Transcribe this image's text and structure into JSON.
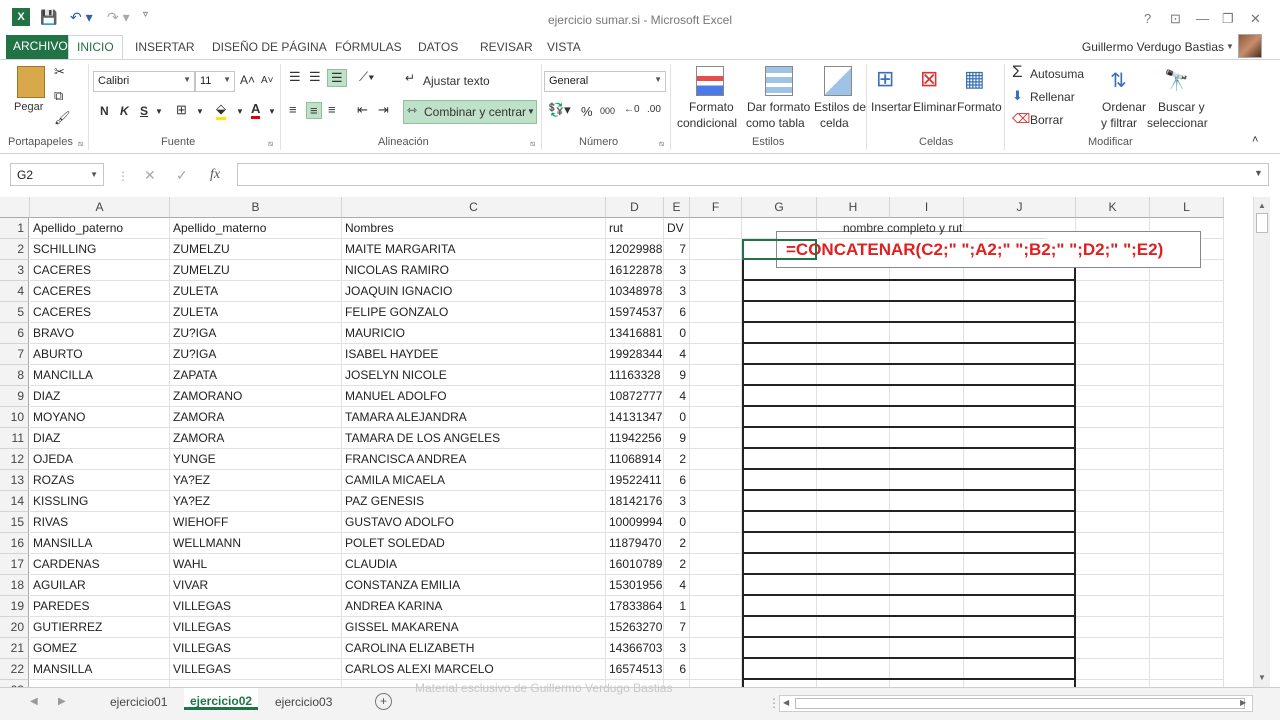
{
  "app": {
    "title": "ejercicio sumar.si - Microsoft Excel",
    "user_name": "Guillermo Verdugo Bastias",
    "help_glyph": "?",
    "minimize_glyph": "—",
    "restore_glyph": "❐",
    "close_glyph": "✕"
  },
  "ribbon_tabs": [
    "ARCHIVO",
    "INICIO",
    "INSERTAR",
    "DISEÑO DE PÁGINA",
    "FÓRMULAS",
    "DATOS",
    "REVISAR",
    "VISTA"
  ],
  "ribbon": {
    "paste_label": "Pegar",
    "clipboard_group": "Portapapeles",
    "font_name": "Calibri",
    "font_size": "11",
    "font_group": "Fuente",
    "bold": "N",
    "italic": "K",
    "underline": "S",
    "wrap_text": "Ajustar texto",
    "merge_center": "Combinar y centrar",
    "alignment_group": "Alineación",
    "number_format": "General",
    "number_group": "Número",
    "percent": "%",
    "thousands": "000",
    "cond_format_1": "Formato",
    "cond_format_2": "condicional",
    "format_table_1": "Dar formato",
    "format_table_2": "como tabla",
    "cell_styles_1": "Estilos de",
    "cell_styles_2": "celda",
    "styles_group": "Estilos",
    "insert_label": "Insertar",
    "delete_label": "Eliminar",
    "format_label": "Formato",
    "cells_group": "Celdas",
    "autosum": "Autosuma",
    "fill": "Rellenar",
    "clear": "Borrar",
    "sort_1": "Ordenar",
    "sort_2": "y filtrar",
    "find_1": "Buscar y",
    "find_2": "seleccionar",
    "editing_group": "Modificar"
  },
  "formula_bar": {
    "name_box": "G2",
    "formula": ""
  },
  "columns": [
    "A",
    "B",
    "C",
    "D",
    "E",
    "F",
    "G",
    "H",
    "I",
    "J",
    "K",
    "L"
  ],
  "headers": {
    "a": "Apellido_paterno",
    "b": "Apellido_materno",
    "c": "Nombres",
    "d": "rut",
    "e": "DV",
    "h": "nombre completo y rut"
  },
  "rows": [
    [
      "SCHILLING",
      "ZUMELZU",
      "MAITE MARGARITA",
      "12029988",
      "7"
    ],
    [
      "CACERES",
      "ZUMELZU",
      "NICOLAS RAMIRO",
      "16122878",
      "3"
    ],
    [
      "CACERES",
      "ZULETA",
      "JOAQUIN IGNACIO",
      "10348978",
      "3"
    ],
    [
      "CACERES",
      "ZULETA",
      "FELIPE GONZALO",
      "15974537",
      "6"
    ],
    [
      "BRAVO",
      "ZU?IGA",
      "MAURICIO",
      "13416881",
      "0"
    ],
    [
      "ABURTO",
      "ZU?IGA",
      "ISABEL HAYDEE",
      "19928344",
      "4"
    ],
    [
      "MANCILLA",
      "ZAPATA",
      "JOSELYN NICOLE",
      "11163328",
      "9"
    ],
    [
      "DIAZ",
      "ZAMORANO",
      "MANUEL ADOLFO",
      "10872777",
      "4"
    ],
    [
      "MOYANO",
      "ZAMORA",
      "TAMARA ALEJANDRA",
      "14131347",
      "0"
    ],
    [
      "DIAZ",
      "ZAMORA",
      "TAMARA DE LOS ANGELES",
      "11942256",
      "9"
    ],
    [
      "OJEDA",
      "YUNGE",
      "FRANCISCA ANDREA",
      "11068914",
      "2"
    ],
    [
      "ROZAS",
      "YA?EZ",
      "CAMILA MICAELA",
      "19522411",
      "6"
    ],
    [
      "KISSLING",
      "YA?EZ",
      "PAZ GENESIS",
      "18142176",
      "3"
    ],
    [
      "RIVAS",
      "WIEHOFF",
      "GUSTAVO ADOLFO",
      "10009994",
      "0"
    ],
    [
      "MANSILLA",
      "WELLMANN",
      "POLET SOLEDAD",
      "11879470",
      "2"
    ],
    [
      "CARDENAS",
      "WAHL",
      "CLAUDIA",
      "16010789",
      "2"
    ],
    [
      "AGUILAR",
      "VIVAR",
      "CONSTANZA EMILIA",
      "15301956",
      "4"
    ],
    [
      "PAREDES",
      "VILLEGAS",
      "ANDREA KARINA",
      "17833864",
      "1"
    ],
    [
      "GUTIERREZ",
      "VILLEGAS",
      "GISSEL MAKARENA",
      "15263270",
      "7"
    ],
    [
      "GOMEZ",
      "VILLEGAS",
      "CAROLINA ELIZABETH",
      "14366703",
      "3"
    ],
    [
      "MANSILLA",
      "VILLEGAS",
      "CARLOS ALEXI MARCELO",
      "16574513",
      "6"
    ]
  ],
  "callout": "=CONCATENAR(C2;\" \";A2;\" \";B2;\" \";D2;\" \";E2)",
  "sheet_tabs": [
    "ejercicio01",
    "ejercicio02",
    "ejercicio03"
  ],
  "active_sheet": "ejercicio02",
  "watermark": "Material esclusivo de Guillermo Verdugo Bastias",
  "colors": {
    "excel_green": "#217346",
    "callout_red": "#e02020"
  }
}
